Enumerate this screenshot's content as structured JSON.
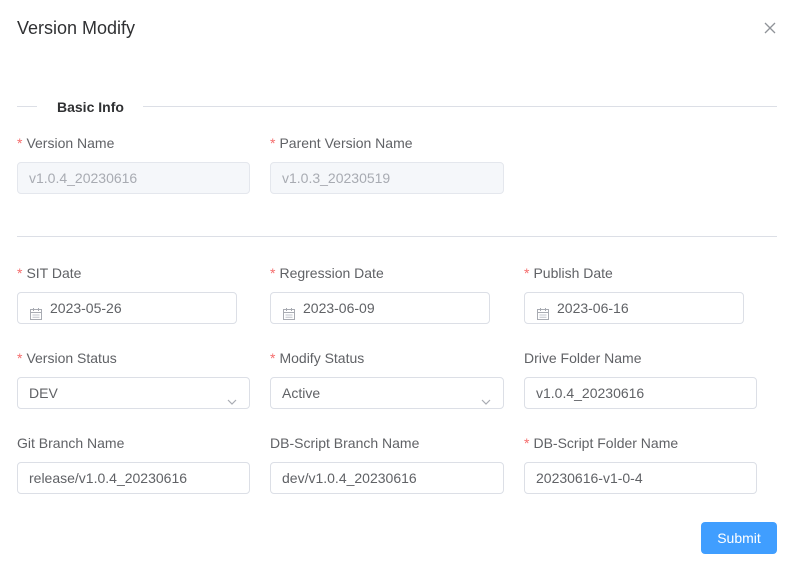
{
  "dialog": {
    "title": "Version Modify"
  },
  "section": {
    "basic_info": "Basic Info"
  },
  "fields": {
    "version_name": {
      "label": "Version Name",
      "value": "v1.0.4_20230616"
    },
    "parent_version_name": {
      "label": "Parent Version Name",
      "value": "v1.0.3_20230519"
    },
    "sit_date": {
      "label": "SIT Date",
      "value": "2023-05-26"
    },
    "regression_date": {
      "label": "Regression Date",
      "value": "2023-06-09"
    },
    "publish_date": {
      "label": "Publish Date",
      "value": "2023-06-16"
    },
    "version_status": {
      "label": "Version Status",
      "value": "DEV"
    },
    "modify_status": {
      "label": "Modify Status",
      "value": "Active"
    },
    "drive_folder_name": {
      "label": "Drive Folder Name",
      "value": "v1.0.4_20230616"
    },
    "git_branch_name": {
      "label": "Git Branch Name",
      "value": "release/v1.0.4_20230616"
    },
    "db_script_branch_name": {
      "label": "DB-Script Branch Name",
      "value": "dev/v1.0.4_20230616"
    },
    "db_script_folder_name": {
      "label": "DB-Script Folder Name",
      "value": "20230616-v1-0-4"
    }
  },
  "required_mark": "*",
  "buttons": {
    "submit": "Submit"
  },
  "icons": {
    "close": "close-icon",
    "calendar": "calendar-icon",
    "dropdown": "chevron-down-icon"
  },
  "colors": {
    "primary": "#409eff",
    "required": "#f56c6c"
  }
}
